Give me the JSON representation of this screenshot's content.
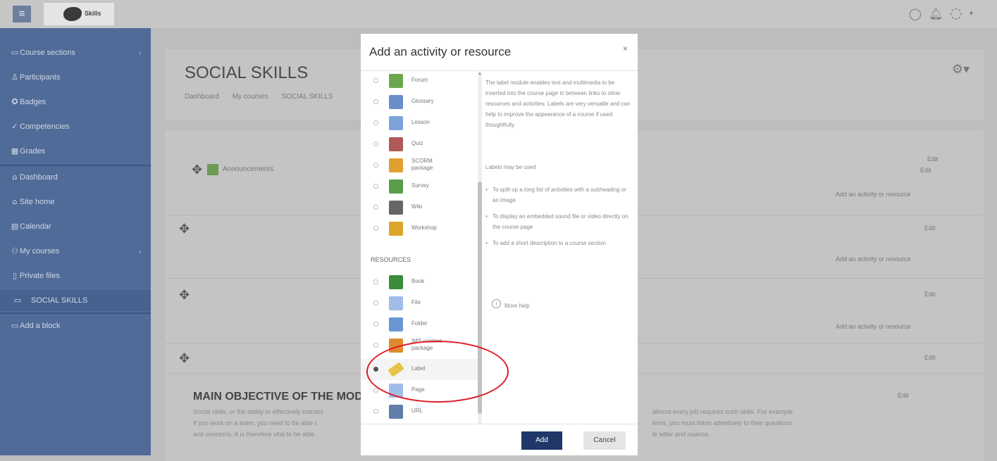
{
  "topbar": {
    "menu_icon": "hamburger-icon",
    "logo_text": "Skills"
  },
  "sidebar": {
    "items": [
      {
        "label": "Course sections",
        "icon": "folder-icon"
      },
      {
        "label": "Participants",
        "icon": "users-icon"
      },
      {
        "label": "Badges",
        "icon": "badge-icon"
      },
      {
        "label": "Competencies",
        "icon": "check-icon"
      },
      {
        "label": "Grades",
        "icon": "grid-icon"
      },
      {
        "label": "Dashboard",
        "icon": "home-icon"
      },
      {
        "label": "Site home",
        "icon": "home-icon"
      },
      {
        "label": "Calendar",
        "icon": "calendar-icon"
      },
      {
        "label": "My courses",
        "icon": "courses-icon"
      },
      {
        "label": "Private files",
        "icon": "file-icon"
      },
      {
        "label": "SOCIAL SKILLS",
        "icon": "folder-icon"
      },
      {
        "label": "Add a block",
        "icon": "add-icon"
      }
    ]
  },
  "course": {
    "title": "SOCIAL SKILLS",
    "breadcrumbs": [
      "Dashboard",
      "My courses",
      "SOCIAL SKILLS"
    ]
  },
  "sections": {
    "announcements": "Announcements",
    "edit_label": "Edit",
    "add_activity": "Add an activity or resource",
    "objective_title": "MAIN OBJECTIVE OF THE MODULE",
    "objective_left_lines": [
      "Social skills, or the ability to effectively interact",
      "If you work on a team, you need to be able t",
      "and concerns. It is therefore vital to be able"
    ],
    "objective_right_lines": [
      "almost every job requires such skills. For example",
      "ients, you must listen attentively to their questions",
      "le letter and nuance."
    ]
  },
  "modal": {
    "title": "Add an activity or resource",
    "close": "×",
    "activities": [
      {
        "label": "Forum",
        "icon": "forum-icon",
        "color": "#6aa84f"
      },
      {
        "label": "Glossary",
        "icon": "glossary-icon",
        "color": "#6b8ec9"
      },
      {
        "label": "Lesson",
        "icon": "lesson-icon",
        "color": "#7ba3d9"
      },
      {
        "label": "Quiz",
        "icon": "quiz-icon",
        "color": "#b05a5a"
      },
      {
        "label": "SCORM package",
        "icon": "scorm-icon",
        "color": "#e0a030"
      },
      {
        "label": "Survey",
        "icon": "survey-icon",
        "color": "#5a9e4a"
      },
      {
        "label": "Wiki",
        "icon": "wiki-icon",
        "color": "#666666"
      },
      {
        "label": "Workshop",
        "icon": "workshop-icon",
        "color": "#d9a62a"
      }
    ],
    "resources_header": "RESOURCES",
    "resources": [
      {
        "label": "Book",
        "icon": "book-icon",
        "color": "#3c8c3c"
      },
      {
        "label": "File",
        "icon": "file-icon",
        "color": "#9fbde8"
      },
      {
        "label": "Folder",
        "icon": "folder-icon",
        "color": "#6b96d4"
      },
      {
        "label": "IMS content package",
        "icon": "ims-icon",
        "color": "#e08a30"
      },
      {
        "label": "Label",
        "icon": "label-icon",
        "color": "#e6c44a",
        "selected": true
      },
      {
        "label": "Page",
        "icon": "page-icon",
        "color": "#9fbde8"
      },
      {
        "label": "URL",
        "icon": "url-icon",
        "color": "#5f7fa8"
      }
    ],
    "description": {
      "para1": "The label module enables text and multimedia to be inserted into the course page in between links to other resources and activities. Labels are very versatile and can help to improve the appearance of a course if used thoughtfully.",
      "para2": "Labels may be used",
      "bullets": [
        "To split up a long list of activities with a subheading or an image",
        "To display an embedded sound file or video directly on the course page",
        "To add a short description to a course section"
      ],
      "more_help": "More help"
    },
    "add_button": "Add",
    "cancel_button": "Cancel"
  }
}
